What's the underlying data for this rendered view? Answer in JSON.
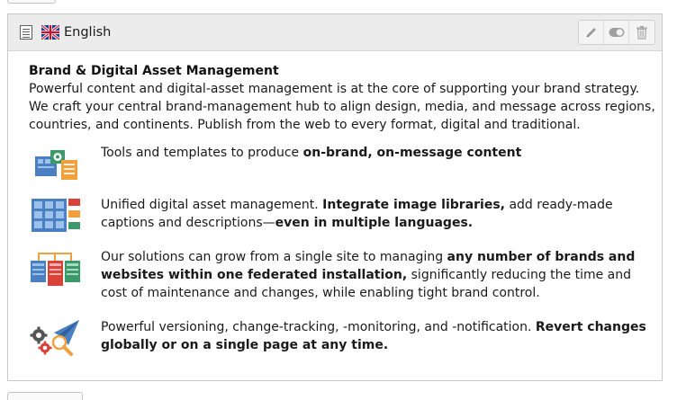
{
  "panel": {
    "language": "English",
    "icons": {
      "page": "page-icon",
      "flag": "uk-flag-icon",
      "edit": "pencil-icon",
      "toggle": "toggle-icon",
      "delete": "trash-icon"
    }
  },
  "content": {
    "headline": "Brand & Digital Asset Management",
    "intro": "Powerful content and digital-asset management is at the core of supporting your brand strategy. We craft your central brand-management hub to align design, media, and message across regions, countries, and continents. Publish from the web to every format, digital and traditional.",
    "features": [
      {
        "icon": "templates-icon",
        "text_before": "Tools and templates to produce ",
        "bold": "on-brand, on-message content",
        "text_after": ""
      },
      {
        "icon": "asset-library-icon",
        "text_before": "Unified digital asset management. ",
        "bold": "Integrate image libraries,",
        "text_middle": " add ready-made captions and descriptions—",
        "bold2": "even in multiple languages."
      },
      {
        "icon": "multisite-icon",
        "text_before": "Our solutions can grow from a single site to managing ",
        "bold": "any number of brands and websites within one federated installation,",
        "text_after": " significantly reducing the time and cost of maintenance and changes, while enabling tight brand control."
      },
      {
        "icon": "versioning-icon",
        "text_before": "Powerful versioning, change-tracking, -monitoring, and -notification. ",
        "bold": "Revert changes globally or on a single page at any time.",
        "text_after": ""
      }
    ]
  },
  "colors": {
    "header_bg": "#ececec",
    "border": "#c9c9c9",
    "icon_blue": "#4a7fc1",
    "icon_orange": "#f0a03c",
    "icon_red": "#d9423a",
    "icon_green": "#3c9a6a"
  }
}
